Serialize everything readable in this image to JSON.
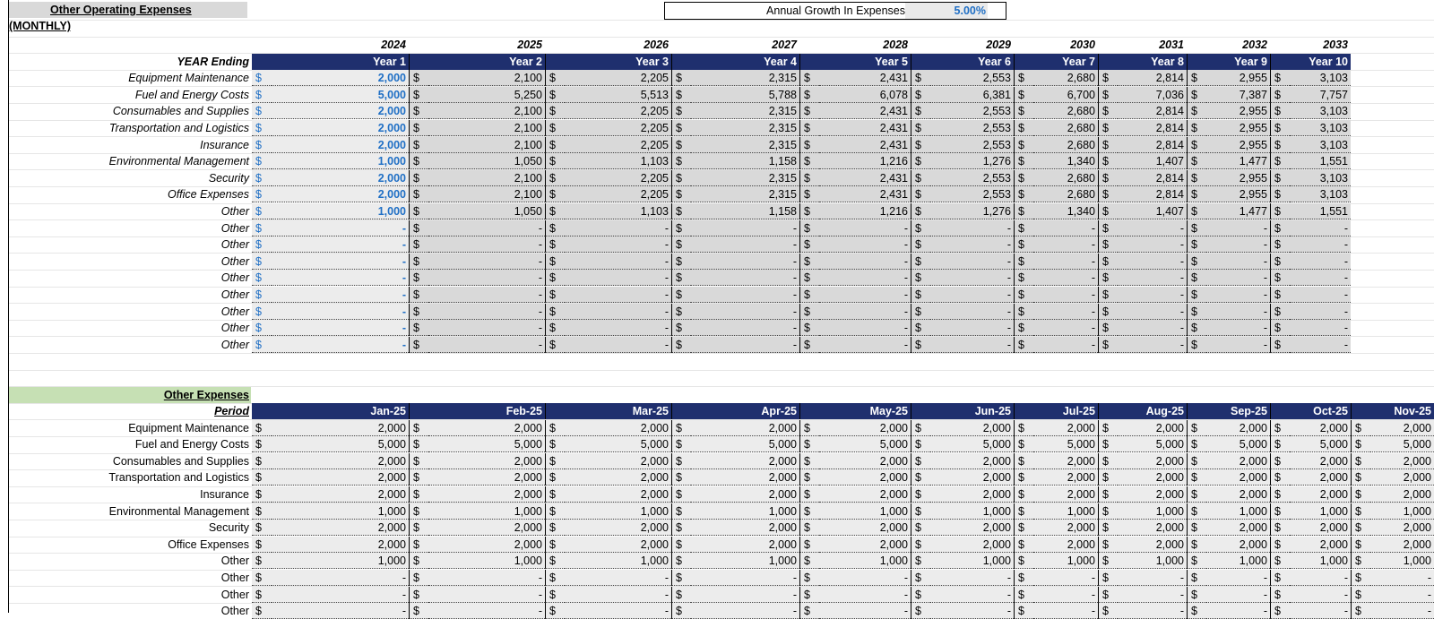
{
  "section1": {
    "title": "Other Operating Expenses (MONTHLY)",
    "growth_label": "Annual Growth In Expenses",
    "growth_value": "5.00%",
    "year_ending_label": "YEAR Ending",
    "years": [
      "2024",
      "2025",
      "2026",
      "2027",
      "2028",
      "2029",
      "2030",
      "2031",
      "2032",
      "2033"
    ],
    "year_labels": [
      "Year 1",
      "Year 2",
      "Year 3",
      "Year 4",
      "Year 5",
      "Year 6",
      "Year 7",
      "Year 8",
      "Year 9",
      "Year 10"
    ],
    "currency": "$",
    "rows": [
      {
        "label": "Equipment Maintenance",
        "values": [
          "2,000",
          "2,100",
          "2,205",
          "2,315",
          "2,431",
          "2,553",
          "2,680",
          "2,814",
          "2,955",
          "3,103"
        ]
      },
      {
        "label": "Fuel and Energy Costs",
        "values": [
          "5,000",
          "5,250",
          "5,513",
          "5,788",
          "6,078",
          "6,381",
          "6,700",
          "7,036",
          "7,387",
          "7,757"
        ]
      },
      {
        "label": "Consumables and Supplies",
        "values": [
          "2,000",
          "2,100",
          "2,205",
          "2,315",
          "2,431",
          "2,553",
          "2,680",
          "2,814",
          "2,955",
          "3,103"
        ]
      },
      {
        "label": "Transportation and Logistics",
        "values": [
          "2,000",
          "2,100",
          "2,205",
          "2,315",
          "2,431",
          "2,553",
          "2,680",
          "2,814",
          "2,955",
          "3,103"
        ]
      },
      {
        "label": "Insurance",
        "values": [
          "2,000",
          "2,100",
          "2,205",
          "2,315",
          "2,431",
          "2,553",
          "2,680",
          "2,814",
          "2,955",
          "3,103"
        ]
      },
      {
        "label": "Environmental Management",
        "values": [
          "1,000",
          "1,050",
          "1,103",
          "1,158",
          "1,216",
          "1,276",
          "1,340",
          "1,407",
          "1,477",
          "1,551"
        ]
      },
      {
        "label": "Security",
        "values": [
          "2,000",
          "2,100",
          "2,205",
          "2,315",
          "2,431",
          "2,553",
          "2,680",
          "2,814",
          "2,955",
          "3,103"
        ]
      },
      {
        "label": "Office Expenses",
        "values": [
          "2,000",
          "2,100",
          "2,205",
          "2,315",
          "2,431",
          "2,553",
          "2,680",
          "2,814",
          "2,955",
          "3,103"
        ]
      },
      {
        "label": "Other",
        "values": [
          "1,000",
          "1,050",
          "1,103",
          "1,158",
          "1,216",
          "1,276",
          "1,340",
          "1,407",
          "1,477",
          "1,551"
        ]
      },
      {
        "label": "Other",
        "values": [
          "-",
          "-",
          "-",
          "-",
          "-",
          "-",
          "-",
          "-",
          "-",
          "-"
        ]
      },
      {
        "label": "Other",
        "values": [
          "-",
          "-",
          "-",
          "-",
          "-",
          "-",
          "-",
          "-",
          "-",
          "-"
        ]
      },
      {
        "label": "Other",
        "values": [
          "-",
          "-",
          "-",
          "-",
          "-",
          "-",
          "-",
          "-",
          "-",
          "-"
        ]
      },
      {
        "label": "Other",
        "values": [
          "-",
          "-",
          "-",
          "-",
          "-",
          "-",
          "-",
          "-",
          "-",
          "-"
        ]
      },
      {
        "label": "Other",
        "values": [
          "-",
          "-",
          "-",
          "-",
          "-",
          "-",
          "-",
          "-",
          "-",
          "-"
        ]
      },
      {
        "label": "Other",
        "values": [
          "-",
          "-",
          "-",
          "-",
          "-",
          "-",
          "-",
          "-",
          "-",
          "-"
        ]
      },
      {
        "label": "Other",
        "values": [
          "-",
          "-",
          "-",
          "-",
          "-",
          "-",
          "-",
          "-",
          "-",
          "-"
        ]
      },
      {
        "label": "Other",
        "values": [
          "-",
          "-",
          "-",
          "-",
          "-",
          "-",
          "-",
          "-",
          "-",
          "-"
        ]
      }
    ]
  },
  "section2": {
    "title": "Other Expenses",
    "period_label": "Period",
    "months": [
      "Jan-25",
      "Feb-25",
      "Mar-25",
      "Apr-25",
      "May-25",
      "Jun-25",
      "Jul-25",
      "Aug-25",
      "Sep-25",
      "Oct-25",
      "Nov-25"
    ],
    "currency": "$",
    "rows": [
      {
        "label": "Equipment Maintenance",
        "values": [
          "2,000",
          "2,000",
          "2,000",
          "2,000",
          "2,000",
          "2,000",
          "2,000",
          "2,000",
          "2,000",
          "2,000",
          "2,000"
        ]
      },
      {
        "label": "Fuel and Energy Costs",
        "values": [
          "5,000",
          "5,000",
          "5,000",
          "5,000",
          "5,000",
          "5,000",
          "5,000",
          "5,000",
          "5,000",
          "5,000",
          "5,000"
        ]
      },
      {
        "label": "Consumables and Supplies",
        "values": [
          "2,000",
          "2,000",
          "2,000",
          "2,000",
          "2,000",
          "2,000",
          "2,000",
          "2,000",
          "2,000",
          "2,000",
          "2,000"
        ]
      },
      {
        "label": "Transportation and Logistics",
        "values": [
          "2,000",
          "2,000",
          "2,000",
          "2,000",
          "2,000",
          "2,000",
          "2,000",
          "2,000",
          "2,000",
          "2,000",
          "2,000"
        ]
      },
      {
        "label": "Insurance",
        "values": [
          "2,000",
          "2,000",
          "2,000",
          "2,000",
          "2,000",
          "2,000",
          "2,000",
          "2,000",
          "2,000",
          "2,000",
          "2,000"
        ]
      },
      {
        "label": "Environmental Management",
        "values": [
          "1,000",
          "1,000",
          "1,000",
          "1,000",
          "1,000",
          "1,000",
          "1,000",
          "1,000",
          "1,000",
          "1,000",
          "1,000"
        ]
      },
      {
        "label": "Security",
        "values": [
          "2,000",
          "2,000",
          "2,000",
          "2,000",
          "2,000",
          "2,000",
          "2,000",
          "2,000",
          "2,000",
          "2,000",
          "2,000"
        ]
      },
      {
        "label": "Office Expenses",
        "values": [
          "2,000",
          "2,000",
          "2,000",
          "2,000",
          "2,000",
          "2,000",
          "2,000",
          "2,000",
          "2,000",
          "2,000",
          "2,000"
        ]
      },
      {
        "label": "Other",
        "values": [
          "1,000",
          "1,000",
          "1,000",
          "1,000",
          "1,000",
          "1,000",
          "1,000",
          "1,000",
          "1,000",
          "1,000",
          "1,000"
        ]
      },
      {
        "label": "Other",
        "values": [
          "-",
          "-",
          "-",
          "-",
          "-",
          "-",
          "-",
          "-",
          "-",
          "-",
          "-"
        ]
      },
      {
        "label": "Other",
        "values": [
          "-",
          "-",
          "-",
          "-",
          "-",
          "-",
          "-",
          "-",
          "-",
          "-",
          "-"
        ]
      },
      {
        "label": "Other",
        "values": [
          "-",
          "-",
          "-",
          "-",
          "-",
          "-",
          "-",
          "-",
          "-",
          "-",
          "-"
        ]
      }
    ]
  }
}
